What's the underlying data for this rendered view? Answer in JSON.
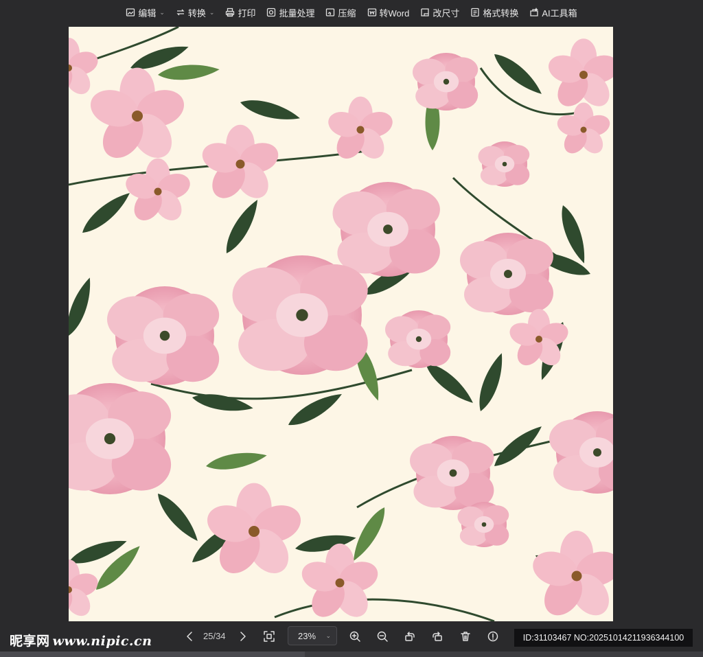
{
  "toolbar": {
    "items": [
      {
        "label": "编辑",
        "icon": "image-edit-icon",
        "has_caret": true
      },
      {
        "label": "转换",
        "icon": "convert-icon",
        "has_caret": true
      },
      {
        "label": "打印",
        "icon": "printer-icon",
        "has_caret": false
      },
      {
        "label": "批量处理",
        "icon": "batch-icon",
        "has_caret": false
      },
      {
        "label": "压缩",
        "icon": "compress-icon",
        "has_caret": false
      },
      {
        "label": "转Word",
        "icon": "word-icon",
        "has_caret": false
      },
      {
        "label": "改尺寸",
        "icon": "resize-icon",
        "has_caret": false
      },
      {
        "label": "格式转换",
        "icon": "format-icon",
        "has_caret": false
      },
      {
        "label": "AI工具箱",
        "icon": "ai-toolbox-icon",
        "has_caret": false
      }
    ]
  },
  "canvas": {
    "background": "#fdf6e6",
    "flower_color": "#f2b8c6",
    "leaf_color": "#2f4a2e"
  },
  "bottom": {
    "watermark_cn": "昵享网",
    "watermark_en": "www.nipic.cn",
    "page_indicator": "25/34",
    "zoom": "23%",
    "id_text": "ID:31103467 NO:20251014211936344100"
  }
}
